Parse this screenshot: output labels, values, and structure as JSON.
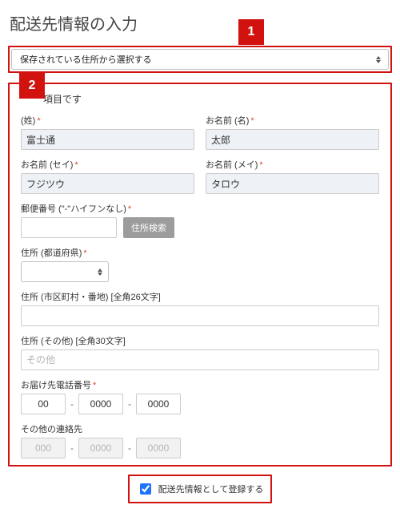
{
  "title": "配送先情報の入力",
  "badges": {
    "one": "1",
    "two": "2"
  },
  "saved_address_select": {
    "label": "保存されている住所から選択する"
  },
  "form": {
    "required_note": "項目です",
    "name": {
      "sei_label": "(姓)",
      "mei_label": "お名前 (名)",
      "sei_value": "富士通",
      "mei_value": "太郎"
    },
    "kana": {
      "sei_label": "お名前 (セイ)",
      "mei_label": "お名前 (メイ)",
      "sei_value": "フジツウ",
      "mei_value": "タロウ"
    },
    "zip": {
      "label": "郵便番号 (\"-\"ハイフンなし)",
      "value": "",
      "search_button": "住所検索"
    },
    "pref": {
      "label": "住所 (都道府県)",
      "value": ""
    },
    "city": {
      "label": "住所 (市区町村・番地) [全角26文字]",
      "value": ""
    },
    "other": {
      "label": "住所 (その他) [全角30文字]",
      "placeholder": "その他",
      "value": ""
    },
    "phone": {
      "label": "お届け先電話番号",
      "p1": "00",
      "p2": "0000",
      "p3": "0000"
    },
    "alt_contact": {
      "label": "その他の連絡先",
      "p1_placeholder": "000",
      "p2_placeholder": "0000",
      "p3_placeholder": "0000"
    }
  },
  "register": {
    "checked": true,
    "label": "配送先情報として登録する"
  }
}
